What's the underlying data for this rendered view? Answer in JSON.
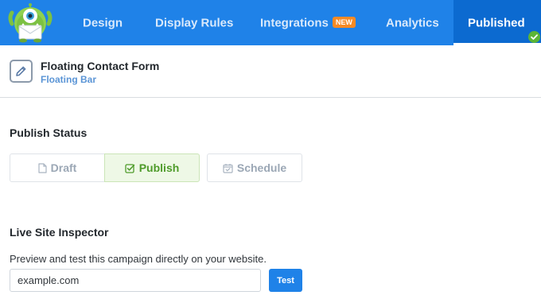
{
  "nav": {
    "design": "Design",
    "display_rules": "Display Rules",
    "integrations": "Integrations",
    "integrations_badge": "NEW",
    "analytics": "Analytics",
    "published": "Published"
  },
  "campaign": {
    "title": "Floating Contact Form",
    "subtitle": "Floating Bar"
  },
  "publish_status": {
    "heading": "Publish Status",
    "options": [
      {
        "label": "Draft",
        "icon": "file-icon",
        "selected": false
      },
      {
        "label": "Publish",
        "icon": "check-square-icon",
        "selected": true
      },
      {
        "label": "Schedule",
        "icon": "calendar-check-icon",
        "selected": false
      }
    ]
  },
  "inspector": {
    "heading": "Live Site Inspector",
    "description": "Preview and test this campaign directly on your website.",
    "url_value": "example.com",
    "test_label": "Test"
  },
  "colors": {
    "nav_bg": "#1f82e8",
    "nav_active_bg": "#0c6ad0",
    "badge_orange": "#f68a25",
    "publish_green": "#4e9b2a",
    "published_check_green": "#5cb536"
  }
}
